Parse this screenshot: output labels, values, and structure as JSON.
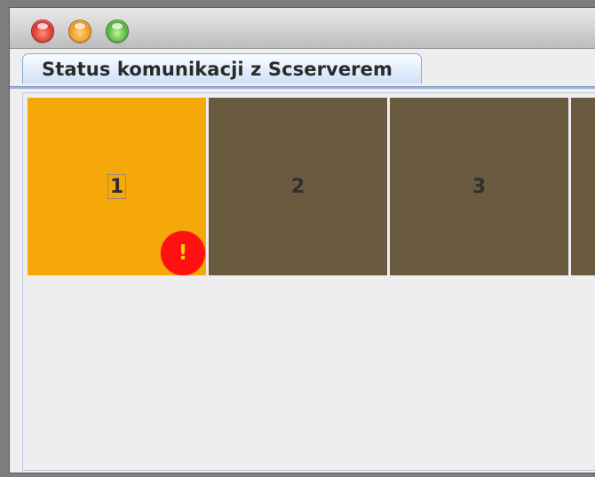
{
  "window": {
    "tab": {
      "label": "Status komunikacji z Scserverem"
    }
  },
  "tiles": [
    {
      "label": "1",
      "status": "active",
      "color": "#F6A70A",
      "warning": "!"
    },
    {
      "label": "2",
      "status": "inactive",
      "color": "#6A5B40"
    },
    {
      "label": "3",
      "status": "inactive",
      "color": "#6A5B40"
    },
    {
      "label": "",
      "status": "inactive",
      "color": "#6A5B40"
    }
  ],
  "colors": {
    "active": "#F6A70A",
    "inactive": "#6A5B40",
    "warning": "#FF1111",
    "warning_mark": "#FFD400"
  },
  "icons": {
    "close": "close-icon",
    "minimize": "minimize-icon",
    "zoom": "zoom-icon",
    "warning": "warning-icon"
  }
}
